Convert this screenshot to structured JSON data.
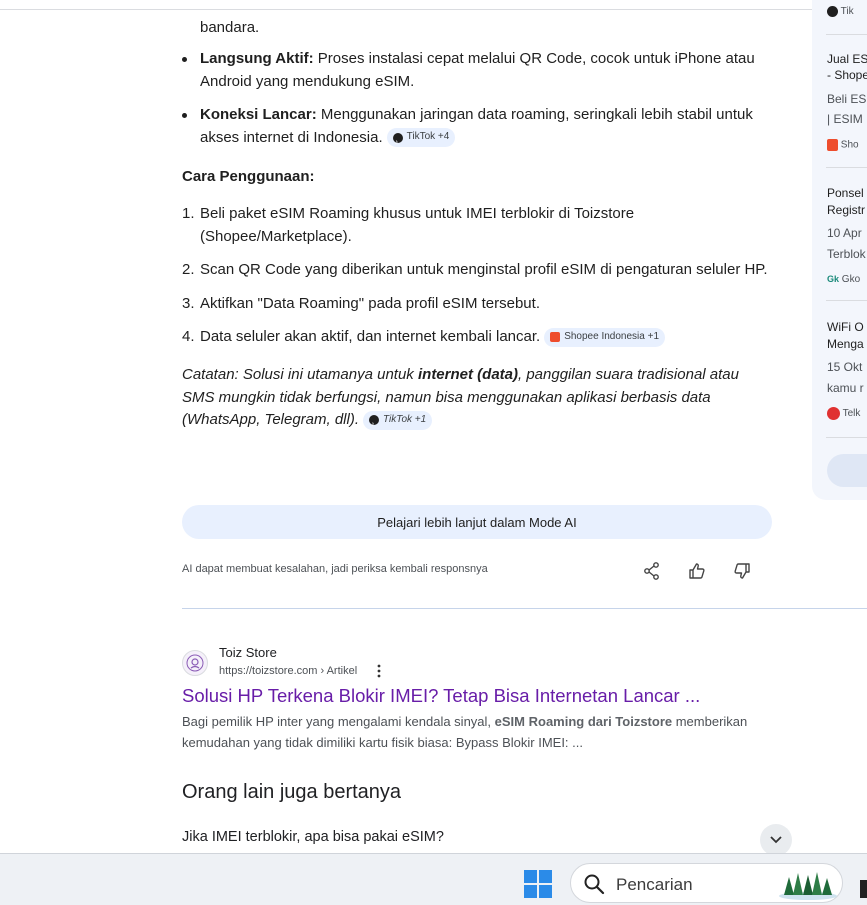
{
  "overview": {
    "cut_line": "bandara.",
    "bullets": [
      {
        "bold": "Langsung Aktif:",
        "text": " Proses instalasi cepat melalui QR Code, cocok untuk iPhone atau Android yang mendukung eSIM."
      },
      {
        "bold": "Koneksi Lancar:",
        "text": " Menggunakan jaringan data roaming, seringkali lebih stabil untuk akses internet di Indonesia.",
        "chip": "TikTok +4"
      }
    ],
    "section_title": "Cara Penggunaan:",
    "steps": [
      {
        "num": "1.",
        "text": "Beli paket eSIM Roaming khusus untuk IMEI terblokir di Toizstore (Shopee/Marketplace)."
      },
      {
        "num": "2.",
        "text": "Scan QR Code yang diberikan untuk menginstal profil eSIM di pengaturan seluler HP."
      },
      {
        "num": "3.",
        "text": "Aktifkan \"Data Roaming\" pada profil eSIM tersebut."
      },
      {
        "num": "4.",
        "text": "Data seluler akan aktif, dan internet kembali lancar.",
        "chip": "Shopee Indonesia +1"
      }
    ],
    "note": {
      "prefix": "Catatan: Solusi ini utamanya untuk ",
      "bold": "internet (data)",
      "suffix": ", panggilan suara tradisional atau SMS mungkin tidak berfungsi, namun bisa menggunakan aplikasi berbasis data (WhatsApp, Telegram, dll).",
      "chip": "TikTok +1"
    },
    "mode_button": "Pelajari lebih lanjut dalam Mode AI",
    "disclaimer": "AI dapat membuat kesalahan, jadi periksa kembali responsnya"
  },
  "result": {
    "site_name": "Toiz Store",
    "url": "https://toizstore.com › Artikel",
    "title": "Solusi HP Terkena Blokir IMEI? Tetap Bisa Internetan Lancar ...",
    "snippet_prefix": "Bagi pemilik HP inter yang mengalami kendala sinyal, ",
    "snippet_bold": "eSIM Roaming dari Toizstore",
    "snippet_suffix": " memberikan kemudahan yang tidak dimiliki kartu fisik biasa: Bypass Blokir IMEI: ..."
  },
  "paa": {
    "title": "Orang lain juga bertanya",
    "question": "Jika IMEI terblokir, apa bisa pakai eSIM?"
  },
  "sidebar": {
    "top_src": "Tik",
    "cards": [
      {
        "title1": "Jual ES",
        "title2": "- Shope",
        "sub1": "Beli ES",
        "sub2": "| ESIM",
        "src": "Sho"
      },
      {
        "title1": "Ponsel",
        "title2": "Registr",
        "sub1": "10 Apr",
        "sub2": "Terblok",
        "src": "Gko"
      },
      {
        "title1": "WiFi O",
        "title2": "Menga",
        "sub1": "15 Okt",
        "sub2": "kamu r",
        "src": "Telk"
      }
    ]
  },
  "taskbar": {
    "search_label": "Pencarian"
  },
  "colors": {
    "link_visited": "#681da8",
    "chip_bg": "#e8f0fe",
    "windows_blue": "#2b8be8",
    "shopee_orange": "#ee4d2d"
  }
}
